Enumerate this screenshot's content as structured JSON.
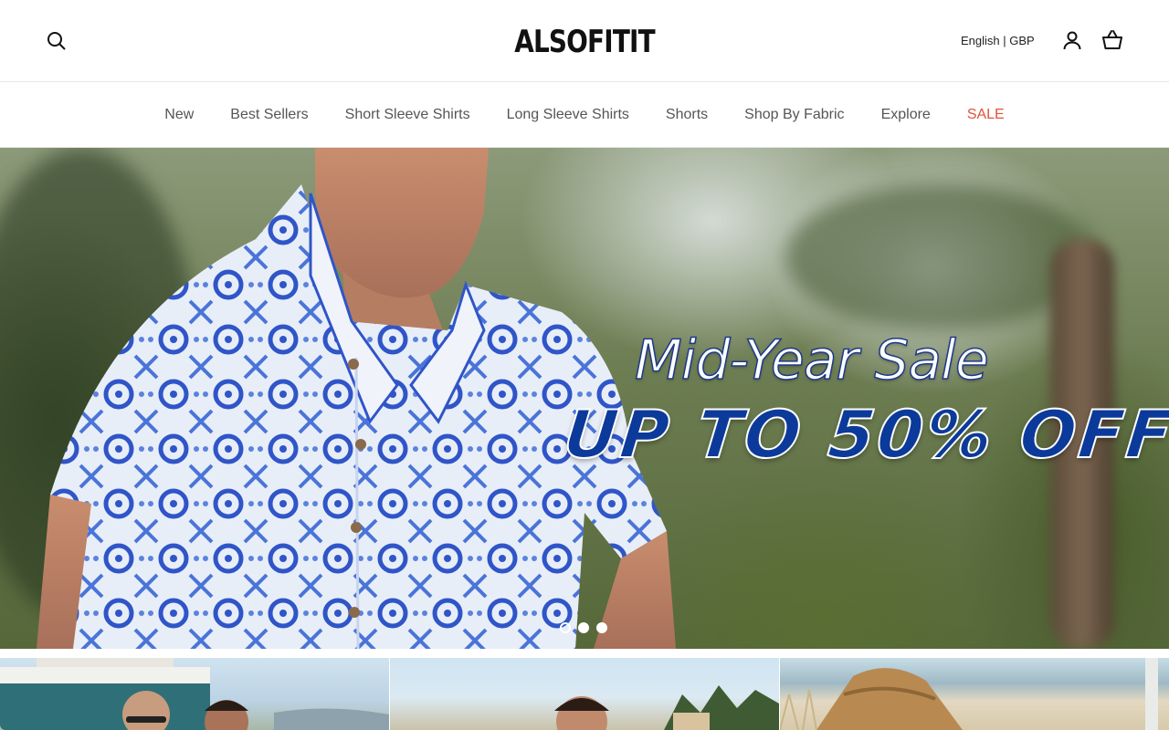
{
  "header": {
    "brand": "ALSOFITIT",
    "locale": "English | GBP",
    "icons": {
      "search": "search-icon",
      "account": "user-icon",
      "cart": "basket-icon"
    }
  },
  "nav": {
    "items": [
      {
        "label": "New"
      },
      {
        "label": "Best Sellers"
      },
      {
        "label": "Short Sleeve Shirts"
      },
      {
        "label": "Long Sleeve Shirts"
      },
      {
        "label": "Shorts"
      },
      {
        "label": "Shop By Fabric"
      },
      {
        "label": "Explore"
      },
      {
        "label": "SALE"
      }
    ],
    "sale_color": "#e0533a"
  },
  "hero": {
    "title": "Mid-Year Sale",
    "subtitle": "UP TO 50% OFF",
    "slide_count": 3,
    "active_slide": 1,
    "colors": {
      "title_outline": "#1e3a8a",
      "subtitle_fill": "#0b3a9b"
    }
  },
  "tiles": {
    "count": 3
  }
}
